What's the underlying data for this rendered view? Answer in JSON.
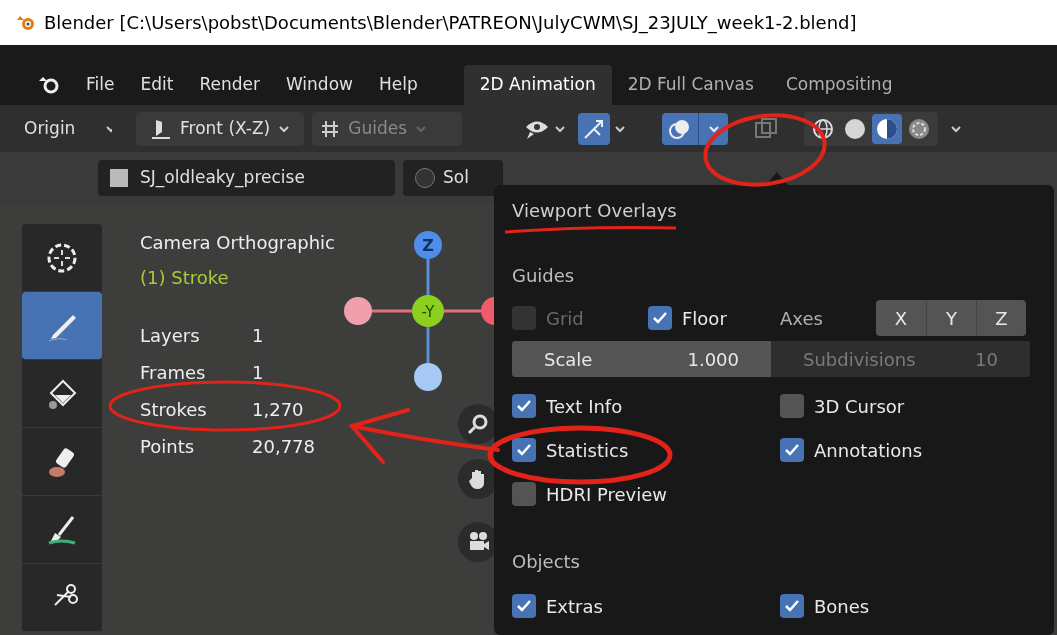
{
  "window": {
    "title": "Blender [C:\\Users\\pobst\\Documents\\Blender\\PATREON\\JulyCWM\\SJ_23JULY_week1-2.blend]"
  },
  "menu": [
    "File",
    "Edit",
    "Render",
    "Window",
    "Help"
  ],
  "workspace_tabs": [
    {
      "label": "2D Animation",
      "selected": true
    },
    {
      "label": "2D Full Canvas",
      "selected": false
    },
    {
      "label": "Compositing",
      "selected": false
    }
  ],
  "header": {
    "pivot": "Origin",
    "view": "Front (X-Z)",
    "guides": "Guides",
    "gizmos_on": true,
    "overlays_on": true,
    "shading_modes": [
      {
        "kind": "wireframe",
        "selected": false
      },
      {
        "kind": "solid",
        "selected": false
      },
      {
        "kind": "material",
        "selected": true
      },
      {
        "kind": "rendered",
        "selected": false
      }
    ]
  },
  "object_bar": {
    "object": "SJ_oldleaky_precise",
    "material": "Sol"
  },
  "tools": [
    {
      "kind": "cursor",
      "selected": false
    },
    {
      "kind": "draw",
      "selected": true
    },
    {
      "kind": "fill",
      "selected": false
    },
    {
      "kind": "erase",
      "selected": false
    },
    {
      "kind": "tint",
      "selected": false
    },
    {
      "kind": "cutter",
      "selected": false
    }
  ],
  "viewport": {
    "view_name": "Camera Orthographic",
    "object_label": "(1) Stroke",
    "stats": [
      {
        "label": "Layers",
        "value": "1"
      },
      {
        "label": "Frames",
        "value": "1"
      },
      {
        "label": "Strokes",
        "value": "1,270"
      },
      {
        "label": "Points",
        "value": "20,778"
      }
    ],
    "gizmo": {
      "z": "Z",
      "y": "-Y"
    }
  },
  "overlays": {
    "title": "Viewport Overlays",
    "guides": {
      "heading": "Guides",
      "grid": {
        "label": "Grid",
        "checked": false,
        "disabled": true
      },
      "floor": {
        "label": "Floor",
        "checked": true
      },
      "axes_label": "Axes",
      "axes": [
        "X",
        "Y",
        "Z"
      ],
      "scale": {
        "label": "Scale",
        "value": "1.000",
        "disabled": false
      },
      "subdivisions": {
        "label": "Subdivisions",
        "value": "10",
        "disabled": true
      },
      "options": [
        {
          "label": "Text Info",
          "checked": true
        },
        {
          "label": "3D Cursor",
          "checked": false
        },
        {
          "label": "Statistics",
          "checked": true
        },
        {
          "label": "Annotations",
          "checked": true
        },
        {
          "label": "HDRI Preview",
          "checked": false
        }
      ]
    },
    "objects": {
      "heading": "Objects",
      "options": [
        {
          "label": "Extras",
          "checked": true
        },
        {
          "label": "Bones",
          "checked": true
        }
      ]
    }
  }
}
